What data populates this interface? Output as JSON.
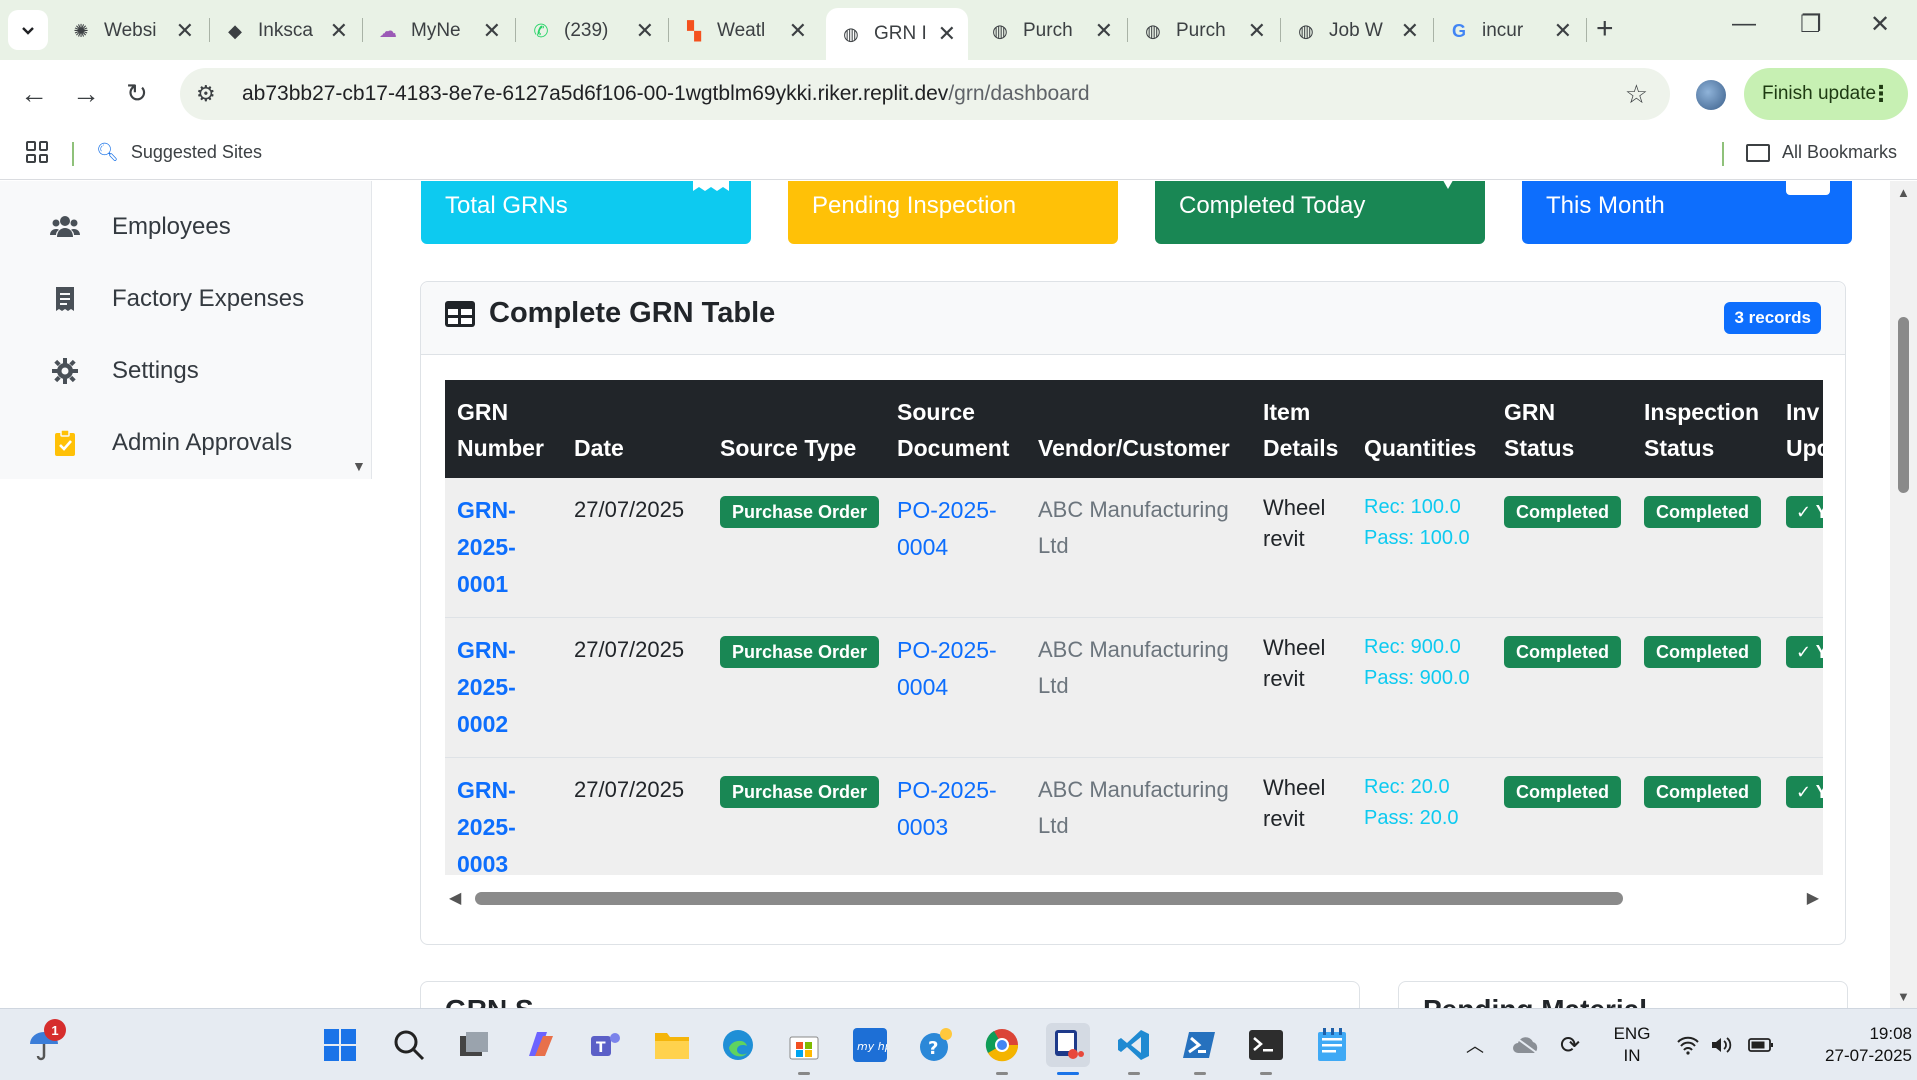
{
  "browser": {
    "tabs": [
      {
        "title": "Websi",
        "icon": "openai-icon"
      },
      {
        "title": "Inksca",
        "icon": "inkscape-icon"
      },
      {
        "title": "MyNe",
        "icon": "mynet-icon"
      },
      {
        "title": "(239)",
        "icon": "whatsapp-icon"
      },
      {
        "title": "Weatl",
        "icon": "weather-icon"
      },
      {
        "title": "GRN I",
        "icon": "globe-icon",
        "active": true
      },
      {
        "title": "Purch",
        "icon": "globe-icon"
      },
      {
        "title": "Purch",
        "icon": "globe-icon"
      },
      {
        "title": "Job W",
        "icon": "globe-icon"
      },
      {
        "title": "incur",
        "icon": "google-icon"
      }
    ],
    "url_host": "ab73bb27-cb17-4183-8e7e-6127a5d6f106-00-1wgtblm69ykki.riker.replit.dev",
    "url_path": "/grn/dashboard",
    "finish_update": "Finish update",
    "bookmarks": {
      "suggested": "Suggested Sites",
      "all": "All Bookmarks"
    }
  },
  "sidebar": {
    "items": [
      {
        "label": "Employees",
        "icon": "users-icon"
      },
      {
        "label": "Factory Expenses",
        "icon": "receipt-icon"
      },
      {
        "label": "Settings",
        "icon": "gear-icon"
      },
      {
        "label": "Admin Approvals",
        "icon": "clipboard-check-icon"
      }
    ]
  },
  "stats": [
    {
      "label": "Total GRNs",
      "color": "#0dcaf0"
    },
    {
      "label": "Pending Inspection",
      "color": "#ffc107"
    },
    {
      "label": "Completed Today",
      "color": "#198754"
    },
    {
      "label": "This Month",
      "color": "#0d6efd"
    }
  ],
  "grn_table": {
    "title": "Complete GRN Table",
    "records_badge": "3 records",
    "headers": {
      "grn_number_1": "GRN",
      "grn_number_2": "Number",
      "date": "Date",
      "source_type": "Source Type",
      "source_doc_1": "Source",
      "source_doc_2": "Document",
      "vendor": "Vendor/Customer",
      "item_1": "Item",
      "item_2": "Details",
      "quantities": "Quantities",
      "grn_status_1": "GRN",
      "grn_status_2": "Status",
      "insp_1": "Inspection",
      "insp_2": "Status",
      "inv_1": "Inv",
      "inv_2": "Upc"
    },
    "rows": [
      {
        "grn_1": "GRN-",
        "grn_2": "2025-",
        "grn_3": "0001",
        "date": "27/07/2025",
        "source_type": "Purchase Order",
        "doc_1": "PO-2025-",
        "doc_2": "0004",
        "vendor_1": "ABC Manufacturing",
        "vendor_2": "Ltd",
        "item_1": "Wheel",
        "item_2": "revit",
        "rec": "Rec: 100.0",
        "pass": "Pass: 100.0",
        "grn_status": "Completed",
        "insp_status": "Completed",
        "inv": "✓ Y"
      },
      {
        "grn_1": "GRN-",
        "grn_2": "2025-",
        "grn_3": "0002",
        "date": "27/07/2025",
        "source_type": "Purchase Order",
        "doc_1": "PO-2025-",
        "doc_2": "0004",
        "vendor_1": "ABC Manufacturing",
        "vendor_2": "Ltd",
        "item_1": "Wheel",
        "item_2": "revit",
        "rec": "Rec: 900.0",
        "pass": "Pass: 900.0",
        "grn_status": "Completed",
        "insp_status": "Completed",
        "inv": "✓ Y"
      },
      {
        "grn_1": "GRN-",
        "grn_2": "2025-",
        "grn_3": "0003",
        "date": "27/07/2025",
        "source_type": "Purchase Order",
        "doc_1": "PO-2025-",
        "doc_2": "0003",
        "vendor_1": "ABC Manufacturing",
        "vendor_2": "Ltd",
        "item_1": "Wheel",
        "item_2": "revit",
        "rec": "Rec: 20.0",
        "pass": "Pass: 20.0",
        "grn_status": "Completed",
        "insp_status": "Completed",
        "inv": "✓ Y"
      }
    ]
  },
  "bottom_peek": {
    "left": "GRN S",
    "right": "Pending Material"
  },
  "taskbar": {
    "notification_count": "1",
    "lang_1": "ENG",
    "lang_2": "IN",
    "time": "19:08",
    "date": "27-07-2025"
  }
}
